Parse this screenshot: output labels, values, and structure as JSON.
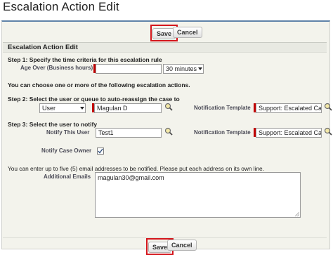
{
  "page": {
    "title": "Escalation Action Edit"
  },
  "buttons": {
    "save": "Save",
    "cancel": "Cancel"
  },
  "section": {
    "title": "Escalation Action Edit"
  },
  "step1": {
    "heading": "Step 1: Specify the time criteria for this escalation rule",
    "age_label": "Age Over (Business hours)",
    "age_value": "",
    "minutes_value": "30 minutes"
  },
  "intro": "You can choose one or more of the following escalation actions.",
  "step2": {
    "heading": "Step 2: Select the user or queue to auto-reassign the case to",
    "owner_type": "User",
    "owner_value": "Magulan D",
    "template_label": "Notification Template",
    "template_value": "Support: Escalated Cas"
  },
  "step3": {
    "heading": "Step 3: Select the user to notify",
    "notify_label": "Notify This User",
    "notify_value": "Test1",
    "template_label": "Notification Template",
    "template_value": "Support: Escalated Cas",
    "owner_label": "Notify Case Owner",
    "owner_checked": true
  },
  "emails": {
    "instructions": "You can enter up to five (5) email addresses to be notified. Please put each address on its own line.",
    "label": "Additional Emails",
    "value": "magulan30@gmail.com"
  },
  "colors": {
    "highlight": "#d4161c",
    "required": "#c10000",
    "header_border": "#5f82a8"
  },
  "icons": {
    "lookup": "magnifier-lookup-icon",
    "dropdown": "chevron-down-icon",
    "check": "checkmark-icon"
  }
}
